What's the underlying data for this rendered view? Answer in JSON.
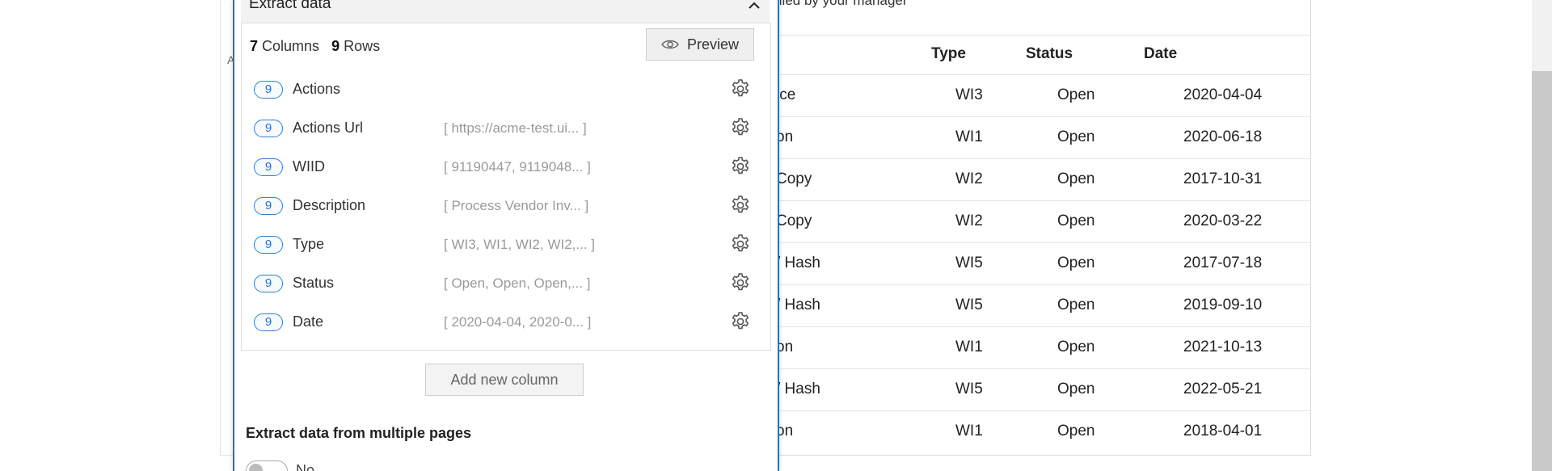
{
  "background_page": {
    "hint_text": "illed by your manager",
    "table": {
      "headers": [
        "Type",
        "Status",
        "Date"
      ],
      "rows": [
        {
          "desc": "ice",
          "type": "WI3",
          "status": "Open",
          "date": "2020-04-04"
        },
        {
          "desc": "on",
          "type": "WI1",
          "status": "Open",
          "date": "2020-06-18"
        },
        {
          "desc": "Copy",
          "type": "WI2",
          "status": "Open",
          "date": "2017-10-31"
        },
        {
          "desc": "Copy",
          "type": "WI2",
          "status": "Open",
          "date": "2020-03-22"
        },
        {
          "desc": "/ Hash",
          "type": "WI5",
          "status": "Open",
          "date": "2017-07-18"
        },
        {
          "desc": "/ Hash",
          "type": "WI5",
          "status": "Open",
          "date": "2019-09-10"
        },
        {
          "desc": "on",
          "type": "WI1",
          "status": "Open",
          "date": "2021-10-13"
        },
        {
          "desc": "/ Hash",
          "type": "WI5",
          "status": "Open",
          "date": "2022-05-21"
        },
        {
          "desc": "on",
          "type": "WI1",
          "status": "Open",
          "date": "2018-04-01"
        }
      ]
    }
  },
  "panel": {
    "title": "Extract data",
    "collapse_icon": "chevron-up-icon",
    "counts": {
      "columns_num": "7",
      "columns_label": "Columns",
      "rows_num": "9",
      "rows_label": "Rows"
    },
    "preview_button": {
      "label": "Preview",
      "icon": "eye-icon"
    },
    "columns": [
      {
        "count": "9",
        "name": "Actions",
        "preview": ""
      },
      {
        "count": "9",
        "name": "Actions Url",
        "preview": "[ https://acme-test.ui...  ]"
      },
      {
        "count": "9",
        "name": "WIID",
        "preview": "[ 91190447, 9119048...  ]"
      },
      {
        "count": "9",
        "name": "Description",
        "preview": "[ Process Vendor Inv...  ]"
      },
      {
        "count": "9",
        "name": "Type",
        "preview": "[ WI3, WI1, WI2, WI2,...  ]"
      },
      {
        "count": "9",
        "name": "Status",
        "preview": "[ Open, Open, Open,...  ]"
      },
      {
        "count": "9",
        "name": "Date",
        "preview": "[ 2020-04-04, 2020-0...  ]"
      }
    ],
    "add_column_label": "Add new column",
    "multi_page": {
      "label": "Extract data from multiple pages",
      "toggle_label": "No",
      "enabled": false
    }
  },
  "colors": {
    "accent": "#2f6fb8",
    "badge_border": "#2f7fd0"
  }
}
